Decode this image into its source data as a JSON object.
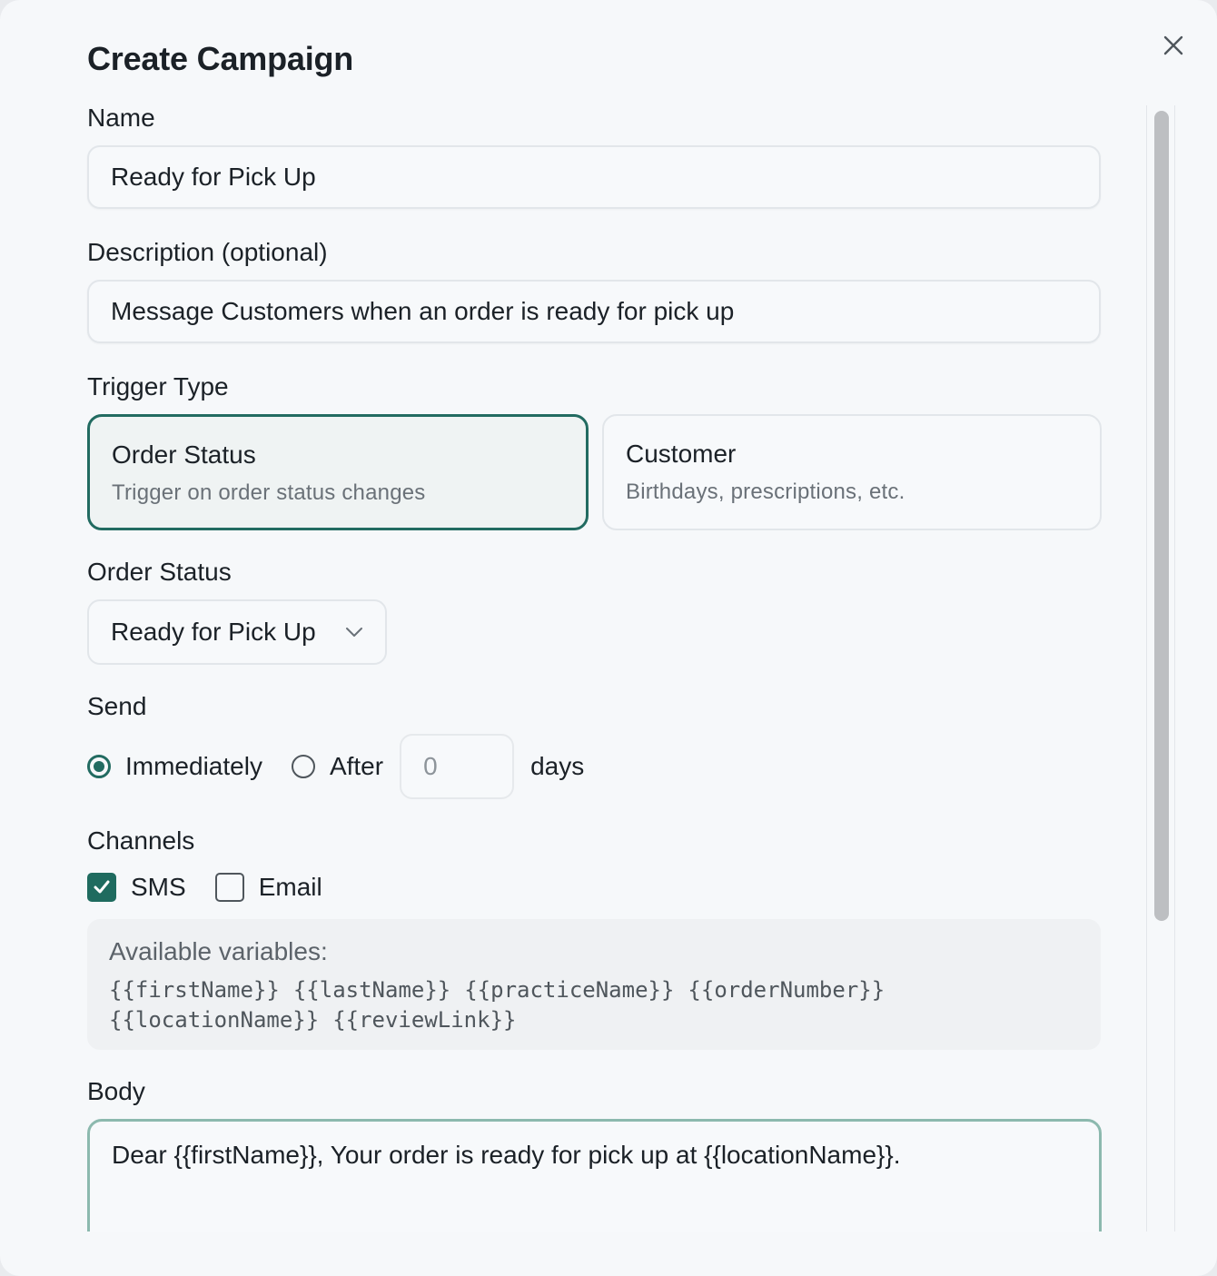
{
  "modal": {
    "title": "Create Campaign"
  },
  "form": {
    "name": {
      "label": "Name",
      "value": "Ready for Pick Up"
    },
    "description": {
      "label": "Description (optional)",
      "value": "Message Customers when an order is ready for pick up"
    },
    "trigger": {
      "label": "Trigger Type",
      "options": [
        {
          "title": "Order Status",
          "subtitle": "Trigger on order status changes",
          "selected": true
        },
        {
          "title": "Customer",
          "subtitle": "Birthdays, prescriptions, etc.",
          "selected": false
        }
      ]
    },
    "order_status": {
      "label": "Order Status",
      "selected": "Ready for Pick Up"
    },
    "send": {
      "label": "Send",
      "immediately_label": "Immediately",
      "after_label": "After",
      "days_value": "0",
      "days_label": "days",
      "selected": "Immediately"
    },
    "channels": {
      "label": "Channels",
      "sms_label": "SMS",
      "sms_checked": true,
      "email_label": "Email",
      "email_checked": false
    },
    "variables": {
      "title": "Available variables:",
      "items": [
        "{{firstName}}",
        "{{lastName}}",
        "{{practiceName}}",
        "{{orderNumber}}",
        "{{locationName}}",
        "{{reviewLink}}"
      ]
    },
    "body": {
      "label": "Body",
      "value": "Dear {{firstName}}, Your order is ready for pick up at {{locationName}}."
    }
  },
  "colors": {
    "accent": "#226b61",
    "border": "#e2e6ea",
    "background": "#f6f8fa"
  }
}
